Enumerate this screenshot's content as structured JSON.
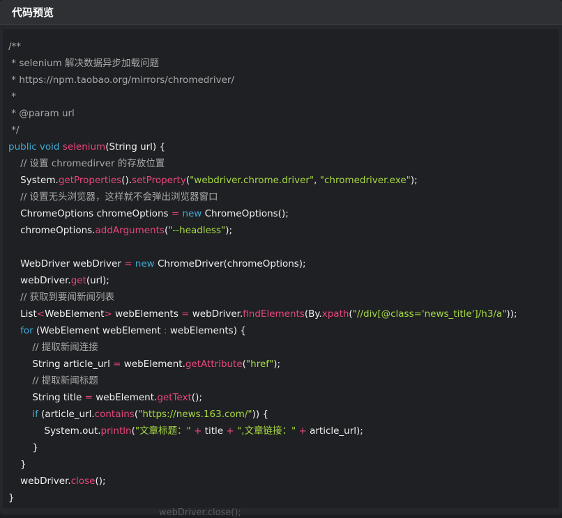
{
  "window": {
    "title": "代码预览"
  },
  "code": {
    "language": "java",
    "lines": [
      [
        {
          "t": "/**",
          "k": "comment"
        }
      ],
      [
        {
          "t": " * selenium 解决数据异步加载问题",
          "k": "comment"
        }
      ],
      [
        {
          "t": " * https://npm.taobao.org/mirrors/chromedriver/",
          "k": "comment"
        }
      ],
      [
        {
          "t": " *",
          "k": "comment"
        }
      ],
      [
        {
          "t": " * @param url",
          "k": "comment"
        }
      ],
      [
        {
          "t": " */",
          "k": "comment"
        }
      ],
      [
        {
          "t": "public",
          "k": "keyword"
        },
        {
          "t": " ",
          "k": "plain"
        },
        {
          "t": "void",
          "k": "keyword"
        },
        {
          "t": " ",
          "k": "plain"
        },
        {
          "t": "selenium",
          "k": "func"
        },
        {
          "t": "(String url) {",
          "k": "plain"
        }
      ],
      [
        {
          "t": "    // 设置 chromedirver 的存放位置",
          "k": "comment"
        }
      ],
      [
        {
          "t": "    System.",
          "k": "plain"
        },
        {
          "t": "getProperties",
          "k": "func"
        },
        {
          "t": "().",
          "k": "plain"
        },
        {
          "t": "setProperty",
          "k": "func"
        },
        {
          "t": "(",
          "k": "plain"
        },
        {
          "t": "\"webdriver.chrome.driver\"",
          "k": "string"
        },
        {
          "t": ", ",
          "k": "plain"
        },
        {
          "t": "\"chromedriver.exe\"",
          "k": "string"
        },
        {
          "t": ");",
          "k": "plain"
        }
      ],
      [
        {
          "t": "    // 设置无头浏览器，这样就不会弹出浏览器窗口",
          "k": "comment"
        }
      ],
      [
        {
          "t": "    ChromeOptions chromeOptions ",
          "k": "plain"
        },
        {
          "t": "=",
          "k": "op"
        },
        {
          "t": " ",
          "k": "plain"
        },
        {
          "t": "new",
          "k": "keyword"
        },
        {
          "t": " ChromeOptions();",
          "k": "plain"
        }
      ],
      [
        {
          "t": "    chromeOptions.",
          "k": "plain"
        },
        {
          "t": "addArguments",
          "k": "func"
        },
        {
          "t": "(",
          "k": "plain"
        },
        {
          "t": "\"--headless\"",
          "k": "string"
        },
        {
          "t": ");",
          "k": "plain"
        }
      ],
      [
        {
          "t": "",
          "k": "plain"
        }
      ],
      [
        {
          "t": "    WebDriver webDriver ",
          "k": "plain"
        },
        {
          "t": "=",
          "k": "op"
        },
        {
          "t": " ",
          "k": "plain"
        },
        {
          "t": "new",
          "k": "keyword"
        },
        {
          "t": " ChromeDriver(chromeOptions);",
          "k": "plain"
        }
      ],
      [
        {
          "t": "    webDriver.",
          "k": "plain"
        },
        {
          "t": "get",
          "k": "func"
        },
        {
          "t": "(url);",
          "k": "plain"
        }
      ],
      [
        {
          "t": "    // 获取到要闻新闻列表",
          "k": "comment"
        }
      ],
      [
        {
          "t": "    List",
          "k": "plain"
        },
        {
          "t": "<",
          "k": "op"
        },
        {
          "t": "WebElement",
          "k": "plain"
        },
        {
          "t": ">",
          "k": "op"
        },
        {
          "t": " webElements ",
          "k": "plain"
        },
        {
          "t": "=",
          "k": "op"
        },
        {
          "t": " webDriver.",
          "k": "plain"
        },
        {
          "t": "findElements",
          "k": "func"
        },
        {
          "t": "(By.",
          "k": "plain"
        },
        {
          "t": "xpath",
          "k": "func"
        },
        {
          "t": "(",
          "k": "plain"
        },
        {
          "t": "\"//div[@class='news_title']/h3/a\"",
          "k": "string"
        },
        {
          "t": "));",
          "k": "plain"
        }
      ],
      [
        {
          "t": "    ",
          "k": "plain"
        },
        {
          "t": "for",
          "k": "keyword"
        },
        {
          "t": " (WebElement webElement ",
          "k": "plain"
        },
        {
          "t": ":",
          "k": "op"
        },
        {
          "t": " webElements) {",
          "k": "plain"
        }
      ],
      [
        {
          "t": "        // 提取新闻连接",
          "k": "comment"
        }
      ],
      [
        {
          "t": "        String article_url ",
          "k": "plain"
        },
        {
          "t": "=",
          "k": "op"
        },
        {
          "t": " webElement.",
          "k": "plain"
        },
        {
          "t": "getAttribute",
          "k": "func"
        },
        {
          "t": "(",
          "k": "plain"
        },
        {
          "t": "\"href\"",
          "k": "string"
        },
        {
          "t": ");",
          "k": "plain"
        }
      ],
      [
        {
          "t": "        // 提取新闻标题",
          "k": "comment"
        }
      ],
      [
        {
          "t": "        String title ",
          "k": "plain"
        },
        {
          "t": "=",
          "k": "op"
        },
        {
          "t": " webElement.",
          "k": "plain"
        },
        {
          "t": "getText",
          "k": "func"
        },
        {
          "t": "();",
          "k": "plain"
        }
      ],
      [
        {
          "t": "        ",
          "k": "plain"
        },
        {
          "t": "if",
          "k": "keyword"
        },
        {
          "t": " (article_url.",
          "k": "plain"
        },
        {
          "t": "contains",
          "k": "func"
        },
        {
          "t": "(",
          "k": "plain"
        },
        {
          "t": "\"https://news.163.com/\"",
          "k": "string"
        },
        {
          "t": ")) {",
          "k": "plain"
        }
      ],
      [
        {
          "t": "            System.out.",
          "k": "plain"
        },
        {
          "t": "println",
          "k": "func"
        },
        {
          "t": "(",
          "k": "plain"
        },
        {
          "t": "\"文章标题：\"",
          "k": "string"
        },
        {
          "t": " ",
          "k": "plain"
        },
        {
          "t": "+",
          "k": "op"
        },
        {
          "t": " title ",
          "k": "plain"
        },
        {
          "t": "+",
          "k": "op"
        },
        {
          "t": " ",
          "k": "plain"
        },
        {
          "t": "\",文章链接：\"",
          "k": "string"
        },
        {
          "t": " ",
          "k": "plain"
        },
        {
          "t": "+",
          "k": "op"
        },
        {
          "t": " article_url);",
          "k": "plain"
        }
      ],
      [
        {
          "t": "        }",
          "k": "plain"
        }
      ],
      [
        {
          "t": "    }",
          "k": "plain"
        }
      ],
      [
        {
          "t": "    webDriver.",
          "k": "plain"
        },
        {
          "t": "close",
          "k": "func"
        },
        {
          "t": "();",
          "k": "plain"
        }
      ],
      [
        {
          "t": "}",
          "k": "plain"
        }
      ]
    ]
  },
  "background": {
    "partially_hidden_text": "webDriver.close();"
  },
  "colors": {
    "comment": "#a9a9a9",
    "keyword": "#3fa9d6",
    "function": "#e8467c",
    "string": "#a6d943",
    "text": "#f0f0f0"
  }
}
